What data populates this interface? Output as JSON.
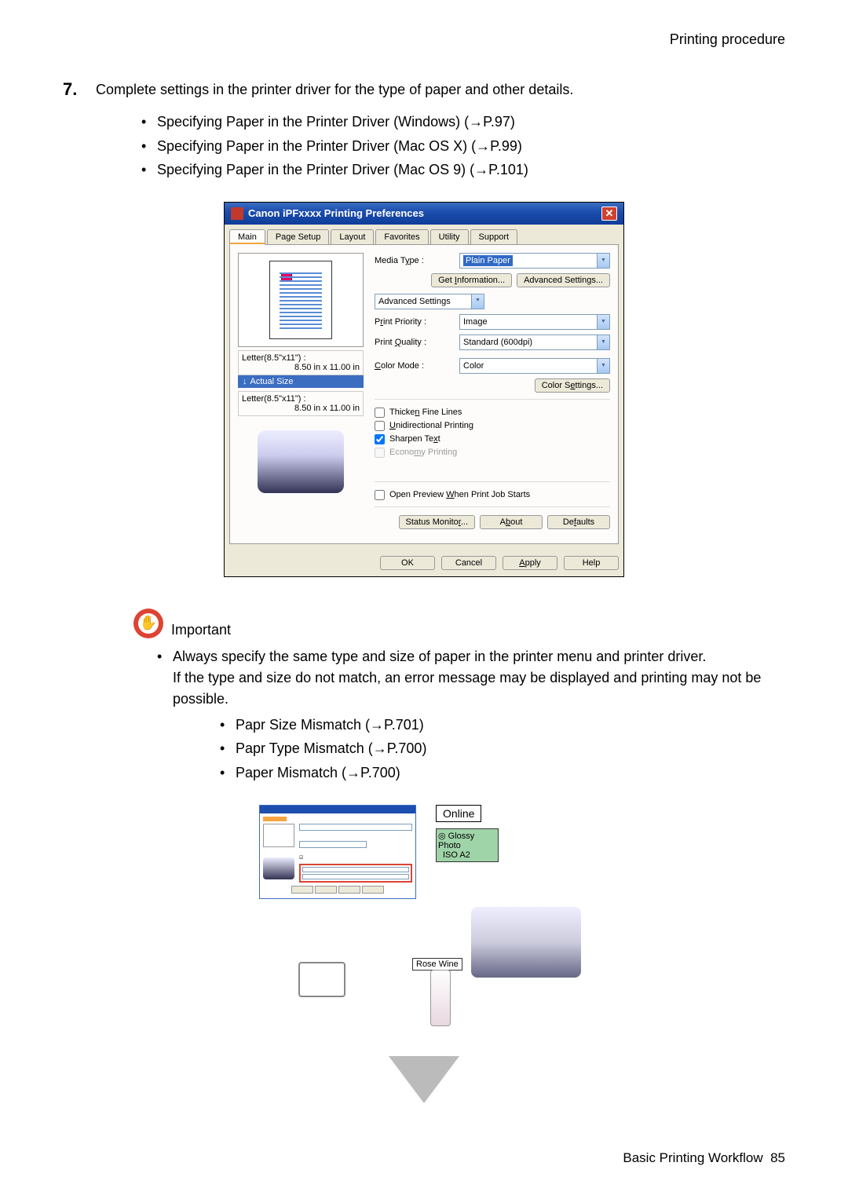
{
  "header": {
    "section": "Printing procedure"
  },
  "step": {
    "number": "7.",
    "text": "Complete settings in the printer driver for the type of paper and other details.",
    "bullets": [
      "Specifying Paper in the Printer Driver (Windows) (→P.97)",
      "Specifying Paper in the Printer Driver (Mac OS X) (→P.99)",
      "Specifying Paper in the Printer Driver (Mac OS 9) (→P.101)"
    ]
  },
  "dialog": {
    "title": "Canon iPFxxxx Printing Preferences",
    "tabs": [
      "Main",
      "Page Setup",
      "Layout",
      "Favorites",
      "Utility",
      "Support"
    ],
    "active_tab": 0,
    "media_type_label": "Media Type :",
    "media_type_value": "Plain Paper",
    "get_info_btn": "Get Information...",
    "adv_settings_btn": "Advanced Settings...",
    "mode_select": "Advanced Settings",
    "print_priority_label": "Print Priority :",
    "print_priority_value": "Image",
    "print_quality_label": "Print Quality :",
    "print_quality_value": "Standard (600dpi)",
    "color_mode_label": "Color Mode :",
    "color_mode_value": "Color",
    "color_settings_btn": "Color Settings...",
    "thicken": "Thicken Fine Lines",
    "unidir": "Unidirectional Printing",
    "sharpen": "Sharpen Text",
    "economy": "Economy Printing",
    "preview_chk": "Open Preview When Print Job Starts",
    "status_monitor": "Status Monitor...",
    "about": "About",
    "defaults": "Defaults",
    "ok": "OK",
    "cancel": "Cancel",
    "apply": "Apply",
    "help": "Help",
    "size1_label": "Letter(8.5\"x11\") :",
    "size1_dim": "8.50 in x 11.00 in",
    "actual_size": "Actual Size",
    "size2_label": "Letter(8.5\"x11\") :",
    "size2_dim": "8.50 in x 11.00 in"
  },
  "important": {
    "label": "Important",
    "text1": "Always specify the same type and size of paper in the printer menu and printer driver.",
    "text2": "If the type and size do not match, an error message may be displayed and printing may not be possible.",
    "bullets": [
      "Papr Size Mismatch (→P.701)",
      "Papr Type Mismatch (→P.700)",
      "Paper Mismatch (→P.700)"
    ]
  },
  "diagram": {
    "online": "Online",
    "glossy": "Glossy Photo",
    "iso": "ISO A2",
    "rose": "Rose Wine"
  },
  "footer": {
    "text": "Basic Printing Workflow",
    "page": "85"
  },
  "underline": {
    "T": "T",
    "W": "W",
    "y": "y",
    "S": "S",
    "U": "U",
    "n": "n",
    "Q": "Q",
    "C": "C",
    "e": "e",
    "x": "x",
    "m": "m",
    "I": "I",
    "r": "r",
    "b": "b",
    "A": "A"
  }
}
